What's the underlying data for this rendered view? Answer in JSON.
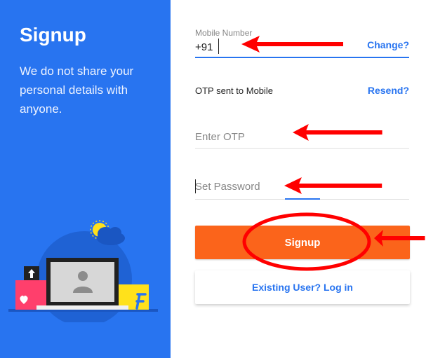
{
  "left_panel": {
    "title": "Signup",
    "description": "We do not share your personal details with anyone.",
    "background_color": "#2874f0",
    "illustration_icons": [
      "sun-icon",
      "cloud-icon",
      "laptop-icon",
      "user-silhouette-icon",
      "heart-icon",
      "upload-arrow-icon",
      "flipkart-f-logo"
    ]
  },
  "form": {
    "mobile": {
      "label": "Mobile Number",
      "value": "+91",
      "action": "Change?"
    },
    "otp_notice": {
      "text": "OTP sent to Mobile",
      "action": "Resend?"
    },
    "otp": {
      "placeholder": "Enter OTP",
      "value": ""
    },
    "password": {
      "placeholder": "Set Password",
      "value": ""
    },
    "signup_button": "Signup",
    "login_button": "Existing User? Log in"
  },
  "colors": {
    "accent_blue": "#2874f0",
    "button_orange": "#fb641b",
    "annotation_red": "#ff0000"
  },
  "annotations": [
    "red-arrow-icon",
    "red-arrow-icon",
    "red-arrow-icon",
    "red-arrow-icon",
    "red-arrow-icon",
    "red-ellipse"
  ]
}
